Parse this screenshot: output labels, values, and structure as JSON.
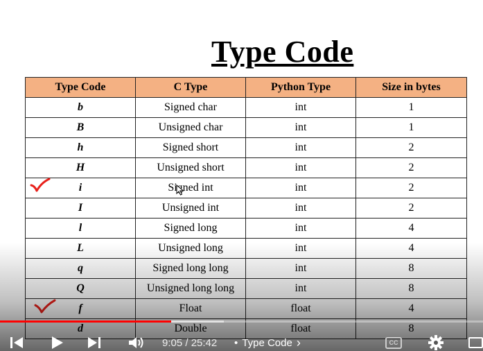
{
  "slide": {
    "title": "Type Code",
    "table": {
      "headers": [
        "Type Code",
        "C Type",
        "Python Type",
        "Size in bytes"
      ],
      "rows": [
        [
          "b",
          "Signed char",
          "int",
          "1"
        ],
        [
          "B",
          "Unsigned char",
          "int",
          "1"
        ],
        [
          "h",
          "Signed short",
          "int",
          "2"
        ],
        [
          "H",
          "Unsigned short",
          "int",
          "2"
        ],
        [
          "i",
          "Signed int",
          "int",
          "2"
        ],
        [
          "I",
          "Unsigned int",
          "int",
          "2"
        ],
        [
          "l",
          "Signed long",
          "int",
          "4"
        ],
        [
          "L",
          "Unsigned long",
          "int",
          "4"
        ],
        [
          "q",
          "Signed long long",
          "int",
          "8"
        ],
        [
          "Q",
          "Unsigned long long",
          "int",
          "8"
        ],
        [
          "f",
          "Float",
          "float",
          "4"
        ],
        [
          "d",
          "Double",
          "float",
          "8"
        ]
      ]
    },
    "checkmarked_rows": [
      "i",
      "f"
    ],
    "colors": {
      "header_fill": "#f4b183",
      "check_mark": "#e8201a"
    }
  },
  "player": {
    "progress_fraction": 0.354,
    "time": "9:05 / 25:42",
    "chapter_separator": "•",
    "chapter": "Type Code",
    "chapter_chevron": "›",
    "cc_label": "CC",
    "colors": {
      "progress": "#ff0000"
    },
    "icons": [
      "previous-icon",
      "play-icon",
      "next-icon",
      "volume-icon",
      "chevron-right-icon",
      "captions-icon",
      "settings-icon",
      "miniplayer-icon"
    ]
  }
}
